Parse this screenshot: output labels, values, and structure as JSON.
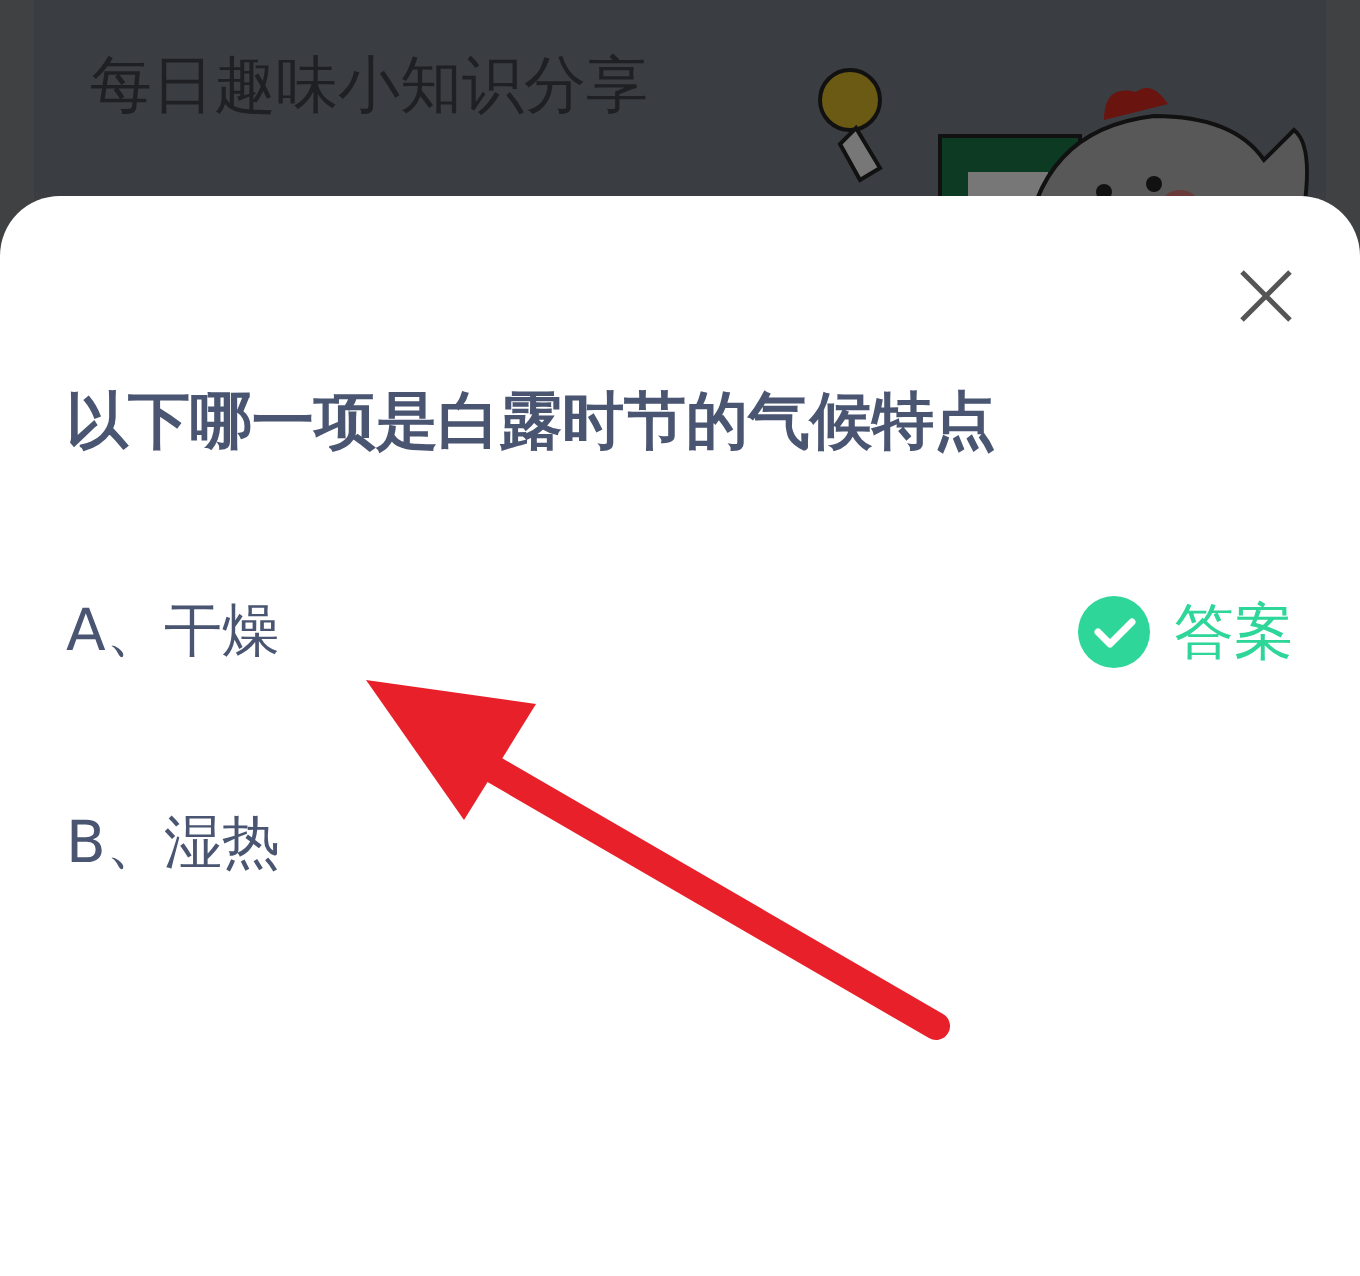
{
  "header": {
    "title": "每日趣味小知识分享"
  },
  "dialog": {
    "question": "以下哪一项是白露时节的气候特点",
    "options": [
      {
        "label": "A、干燥",
        "is_answer": true,
        "answer_label": "答案"
      },
      {
        "label": "B、湿热",
        "is_answer": false
      }
    ]
  }
}
